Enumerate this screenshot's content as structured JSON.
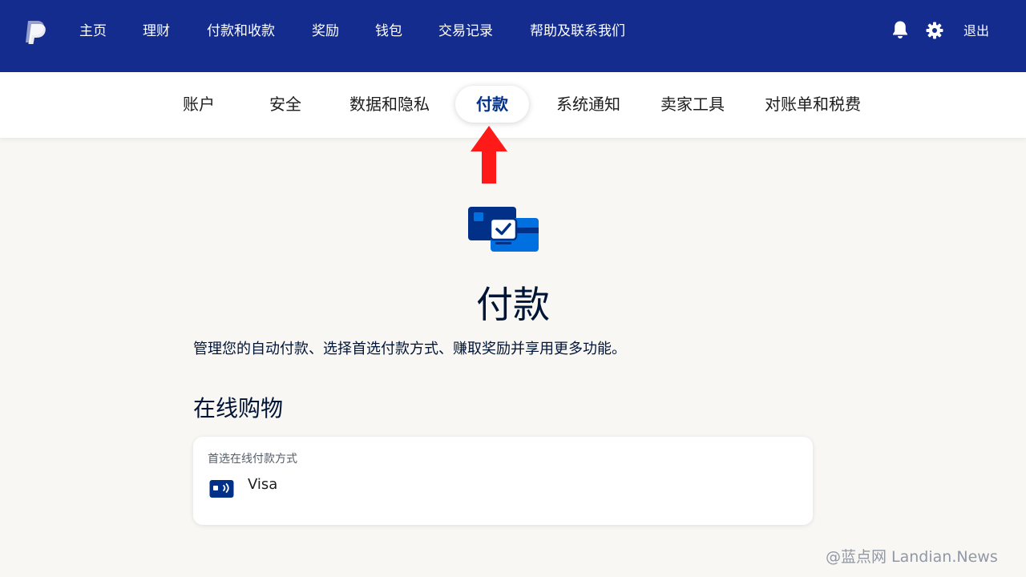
{
  "topnav": {
    "logo_icon": "paypal-logo-icon",
    "items": [
      {
        "label": "主页"
      },
      {
        "label": "理财"
      },
      {
        "label": "付款和收款"
      },
      {
        "label": "奖励"
      },
      {
        "label": "钱包"
      },
      {
        "label": "交易记录"
      },
      {
        "label": "帮助及联系我们"
      }
    ],
    "notifications_icon": "bell-icon",
    "settings_icon": "gear-icon",
    "logout_label": "退出"
  },
  "subnav": {
    "items": [
      {
        "label": "账户",
        "active": false
      },
      {
        "label": "安全",
        "active": false
      },
      {
        "label": "数据和隐私",
        "active": false
      },
      {
        "label": "付款",
        "active": true
      },
      {
        "label": "系统通知",
        "active": false
      },
      {
        "label": "卖家工具",
        "active": false
      },
      {
        "label": "对账单和税费",
        "active": false
      }
    ]
  },
  "annotation": {
    "icon": "red-arrow-up-icon",
    "color": "#ff1a1a"
  },
  "main": {
    "hero_icon": "payment-cards-check-icon",
    "title": "付款",
    "description": "管理您的自动付款、选择首选付款方式、赚取奖励并享用更多功能。",
    "section_title": "在线购物",
    "card": {
      "label": "首选在线付款方式",
      "method_icon": "credit-card-icon",
      "method_name": "Visa"
    }
  },
  "watermark": "@蓝点网 Landian.News",
  "colors": {
    "header_bg": "#142c8e",
    "page_bg": "#f8f7f4",
    "active_tab_text": "#003087",
    "card_blue_dark": "#003087",
    "card_blue_light": "#0070e0"
  }
}
